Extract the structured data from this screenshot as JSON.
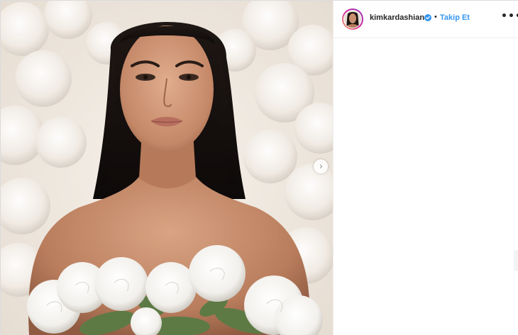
{
  "post": {
    "username": "kimkardashian",
    "verified": true,
    "separator": "•",
    "follow_label": "Takip Et",
    "more_label": "•••",
    "next_arrow": "chevron-right-icon"
  },
  "colors": {
    "accent": "#3897f0",
    "text": "#262626",
    "border": "#efefef"
  }
}
